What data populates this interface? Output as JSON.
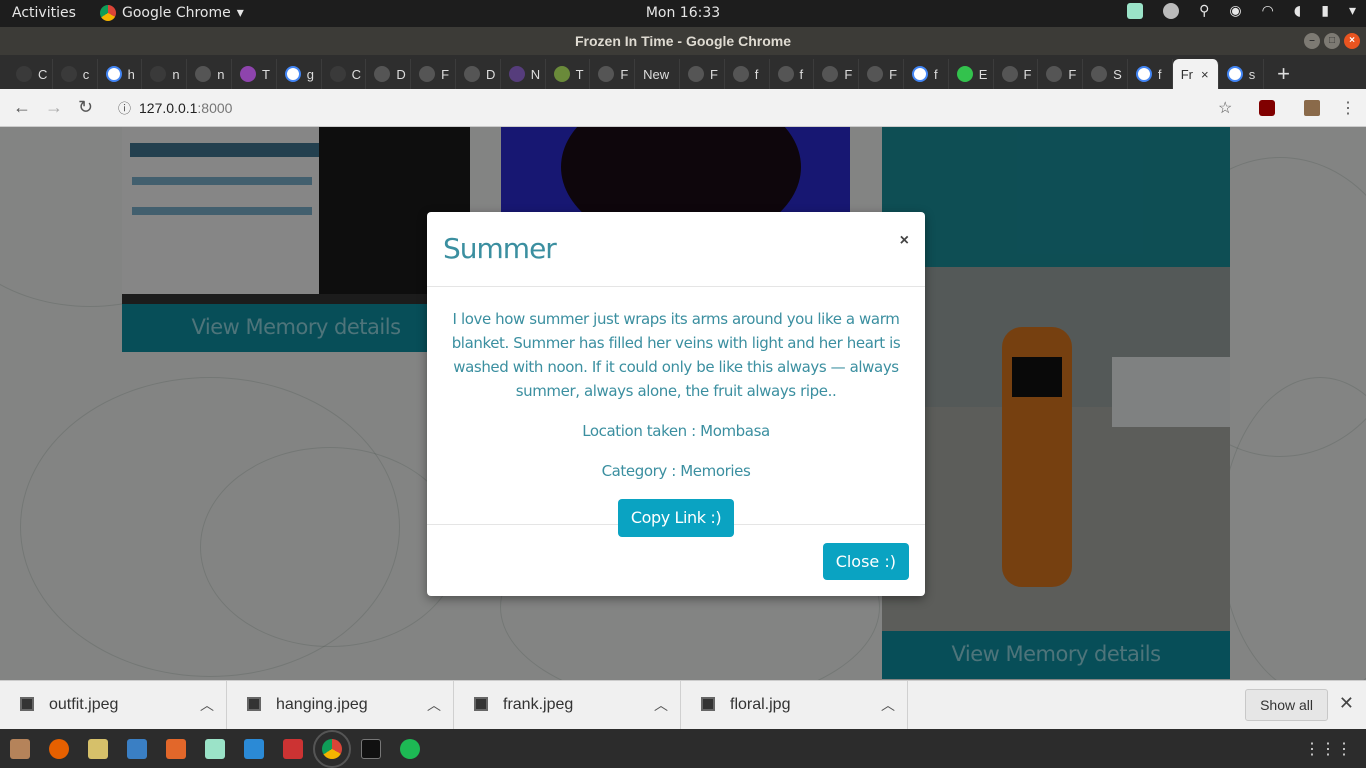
{
  "topbar": {
    "activities": "Activities",
    "app_name": "Google Chrome",
    "clock": "Mon 16:33"
  },
  "window": {
    "title": "Frozen In Time - Google Chrome"
  },
  "tabs": [
    {
      "label": "C",
      "icon": "github-icon"
    },
    {
      "label": "c",
      "icon": "github-icon"
    },
    {
      "label": "h",
      "icon": "google-icon"
    },
    {
      "label": "n",
      "icon": "github-icon"
    },
    {
      "label": "n",
      "icon": "sparkle-icon"
    },
    {
      "label": "T",
      "icon": "h-logo-icon"
    },
    {
      "label": "g",
      "icon": "google-icon"
    },
    {
      "label": "C",
      "icon": "github-icon"
    },
    {
      "label": "D",
      "icon": "globe-icon"
    },
    {
      "label": "F",
      "icon": "globe-icon"
    },
    {
      "label": "D",
      "icon": "globe-icon"
    },
    {
      "label": "N",
      "icon": "bootstrap-icon"
    },
    {
      "label": "T",
      "icon": "palm-icon"
    },
    {
      "label": "F",
      "icon": "globe-icon"
    },
    {
      "label": "New",
      "icon": ""
    },
    {
      "label": "F",
      "icon": "globe-icon"
    },
    {
      "label": "f",
      "icon": "globe-icon"
    },
    {
      "label": "f",
      "icon": "globe-icon"
    },
    {
      "label": "F",
      "icon": "globe-icon"
    },
    {
      "label": "F",
      "icon": "globe-icon"
    },
    {
      "label": "f",
      "icon": "google-icon"
    },
    {
      "label": "E",
      "icon": "px-icon"
    },
    {
      "label": "F",
      "icon": "globe-icon"
    },
    {
      "label": "F",
      "icon": "globe-icon"
    },
    {
      "label": "S",
      "icon": "globe-icon"
    },
    {
      "label": "f",
      "icon": "google-icon"
    },
    {
      "label": "Fr",
      "icon": "",
      "active": true
    },
    {
      "label": "s",
      "icon": "google-icon"
    }
  ],
  "omnibox": {
    "host": "127.0.0.1",
    "port": ":8000"
  },
  "page": {
    "cards": [
      {
        "button": "View Memory details"
      },
      {
        "button": "View Memory details"
      }
    ]
  },
  "modal": {
    "title": "Summer",
    "close_x": "×",
    "description": "I love how summer just wraps its arms around you like a warm blanket. Summer has filled her veins with light and her heart is washed with noon. If it could only be like this always — always summer, always alone, the fruit always ripe..",
    "location": "Location taken : Mombasa",
    "category": "Category : Memories",
    "copy_label": "Copy Link :)",
    "close_label": "Close :)"
  },
  "downloads": {
    "items": [
      "outfit.jpeg",
      "hanging.jpeg",
      "frank.jpeg",
      "floral.jpg"
    ],
    "show_all": "Show all"
  },
  "colors": {
    "accent": "#0aa3c2",
    "title_text": "#3b8fa0",
    "card_button": "#0e8fa1"
  }
}
